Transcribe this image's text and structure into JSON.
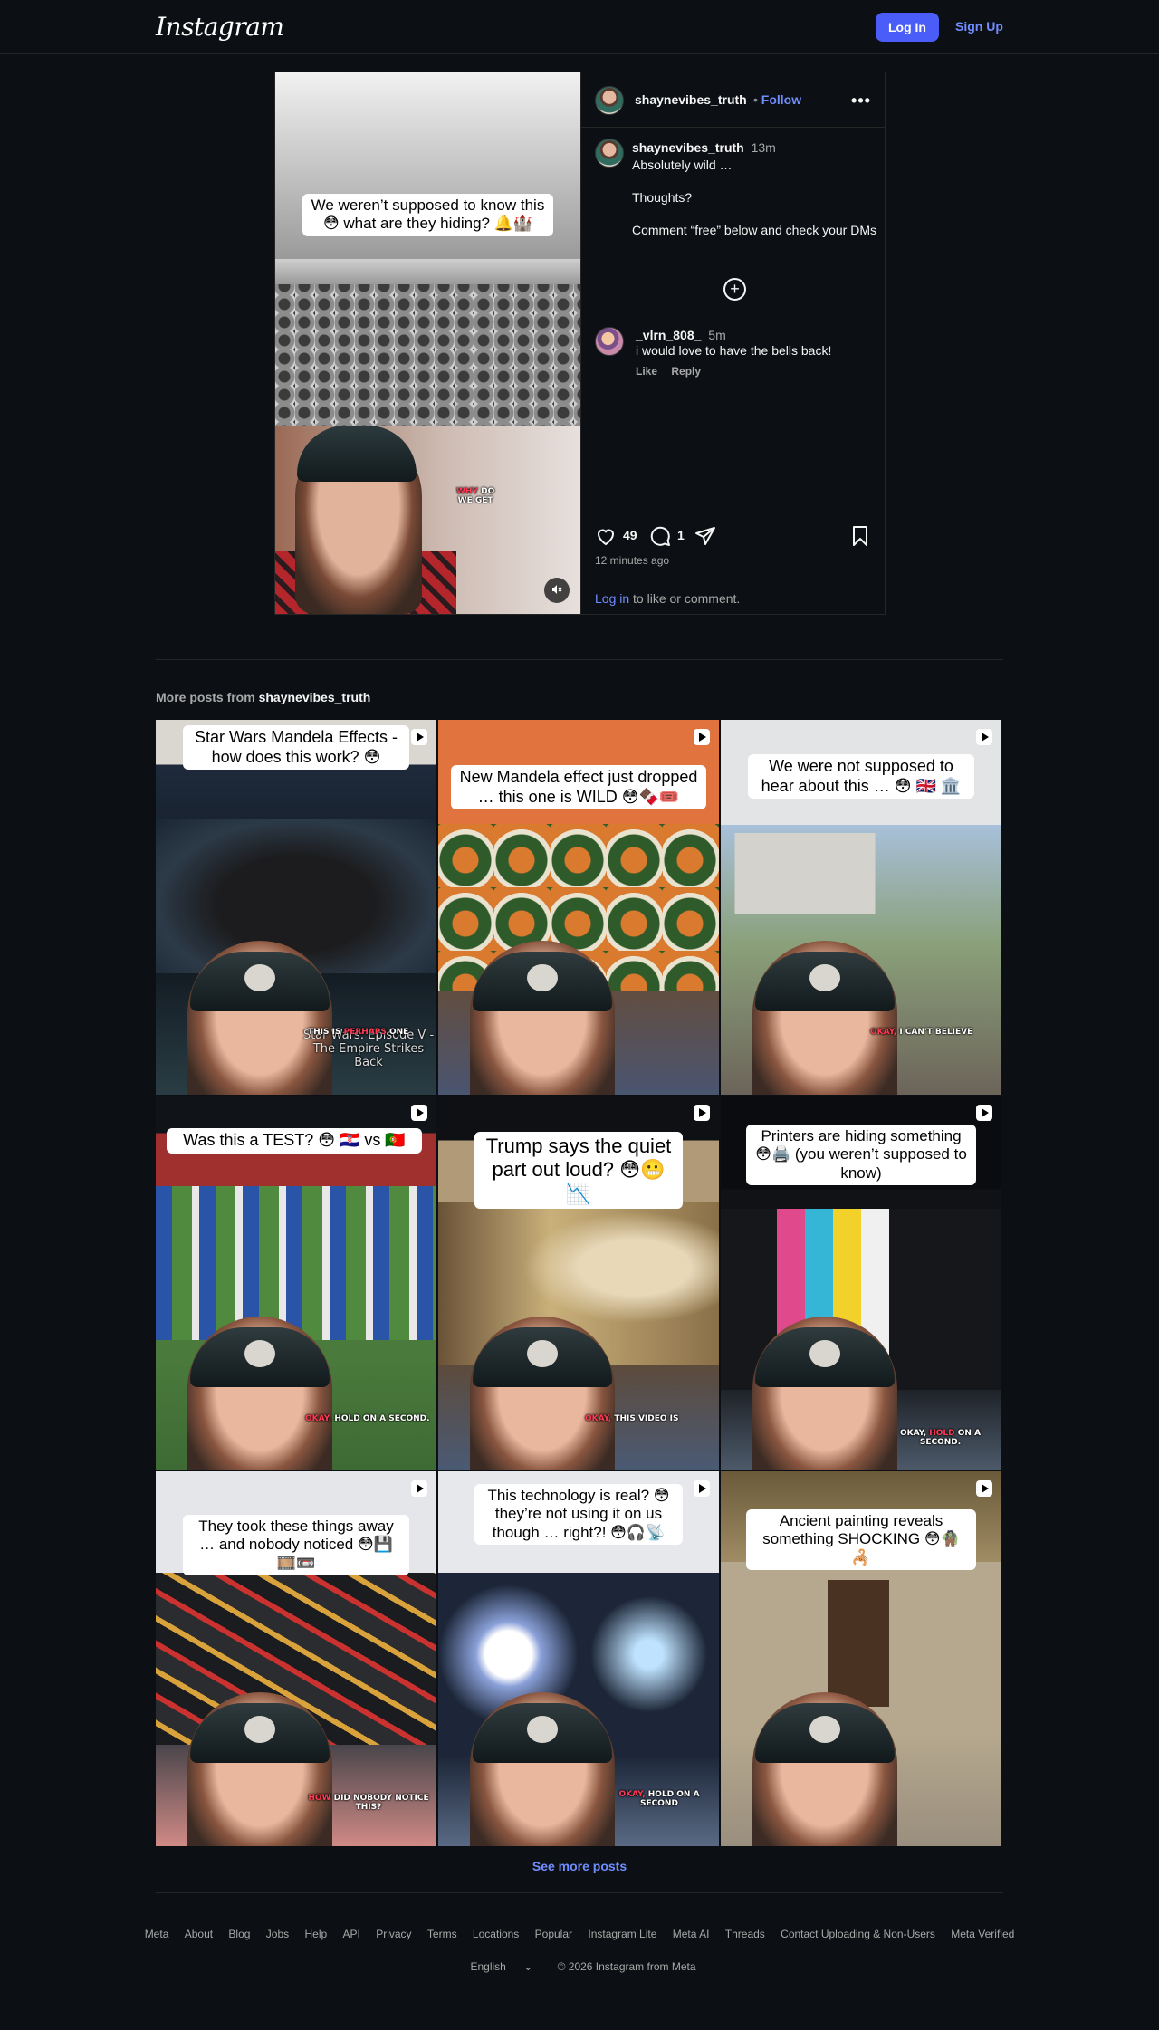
{
  "header": {
    "logo": "Instagram",
    "login_label": "Log In",
    "signup_label": "Sign Up"
  },
  "post": {
    "username": "shaynevibes_truth",
    "follow_label": "Follow",
    "more_label": "•••",
    "media_caption": "We weren’t supposed to know this 😳 what are they hiding? 🔔🏰",
    "overlay_red": "WHY",
    "overlay_white": "DO",
    "overlay_line2": "WE GET",
    "caption": {
      "username": "shaynevibes_truth",
      "time": "13m",
      "text": "Absolutely wild …\n\nThoughts?\n\nComment “free” below and check your DMs"
    },
    "expand_label": "+",
    "comment": {
      "username": "_vlrn_808_",
      "time": "5m",
      "text": "i would love to have the bells back!",
      "like_label": "Like",
      "reply_label": "Reply"
    },
    "likes": "49",
    "comments": "1",
    "timestamp": "12 minutes ago",
    "login_link": "Log in",
    "login_suffix": "to like or comment."
  },
  "more": {
    "prefix": "More posts from",
    "username": "shaynevibes_truth",
    "tiles": [
      {
        "caption": "Star Wars Mandela Effects - how does this work? 😳",
        "overlay": "THIS IS PERHAPS ONE",
        "overlay_red": "PERHAPS",
        "extra": "Star Wars: Episode V - The Empire Strikes Back"
      },
      {
        "caption": "New Mandela effect just dropped … this one is WILD 😳🍫🎟️",
        "overlay": "",
        "overlay_red": ""
      },
      {
        "caption": "We were not supposed to hear about this … 😳 🇬🇧 🏛️",
        "overlay": "OKAY, I CAN'T BELIEVE",
        "overlay_red": "OKAY,"
      },
      {
        "caption": "Was this a TEST? 😳 🇭🇷 vs 🇵🇹",
        "overlay": "OKAY, HOLD ON A SECOND.",
        "overlay_red": "OKAY,"
      },
      {
        "caption": "Trump says the quiet part out loud? 😳😬📉",
        "overlay": "OKAY, THIS VIDEO IS",
        "overlay_red": "OKAY,"
      },
      {
        "caption": "Printers are hiding something 😳🖨️ (you weren’t supposed to know)",
        "overlay": "OKAY, HOLD ON A SECOND.",
        "overlay_red": "HOLD"
      },
      {
        "caption": "They took these things away … and nobody noticed 😳💾🎞️📼",
        "overlay": "HOW DID NOBODY NOTICE THIS?",
        "overlay_red": "HOW"
      },
      {
        "caption": "This technology is real? 😳 they’re not using it on us though … right?! 😳🎧📡",
        "overlay": "OKAY, HOLD ON A SECOND",
        "overlay_red": "OKAY,"
      },
      {
        "caption": "Ancient painting reveals something SHOCKING 😳🧌🦂",
        "overlay": "",
        "overlay_red": ""
      }
    ],
    "see_more": "See more posts"
  },
  "footer": {
    "links": [
      "Meta",
      "About",
      "Blog",
      "Jobs",
      "Help",
      "API",
      "Privacy",
      "Terms",
      "Locations",
      "Popular",
      "Instagram Lite",
      "Meta AI",
      "Threads",
      "Contact Uploading & Non-Users",
      "Meta Verified"
    ],
    "language": "English",
    "copyright": "© 2026 Instagram from Meta"
  },
  "colors": {
    "background": "#0c1014",
    "accent": "#4a5df9",
    "link": "#708dff",
    "border": "#262626"
  }
}
